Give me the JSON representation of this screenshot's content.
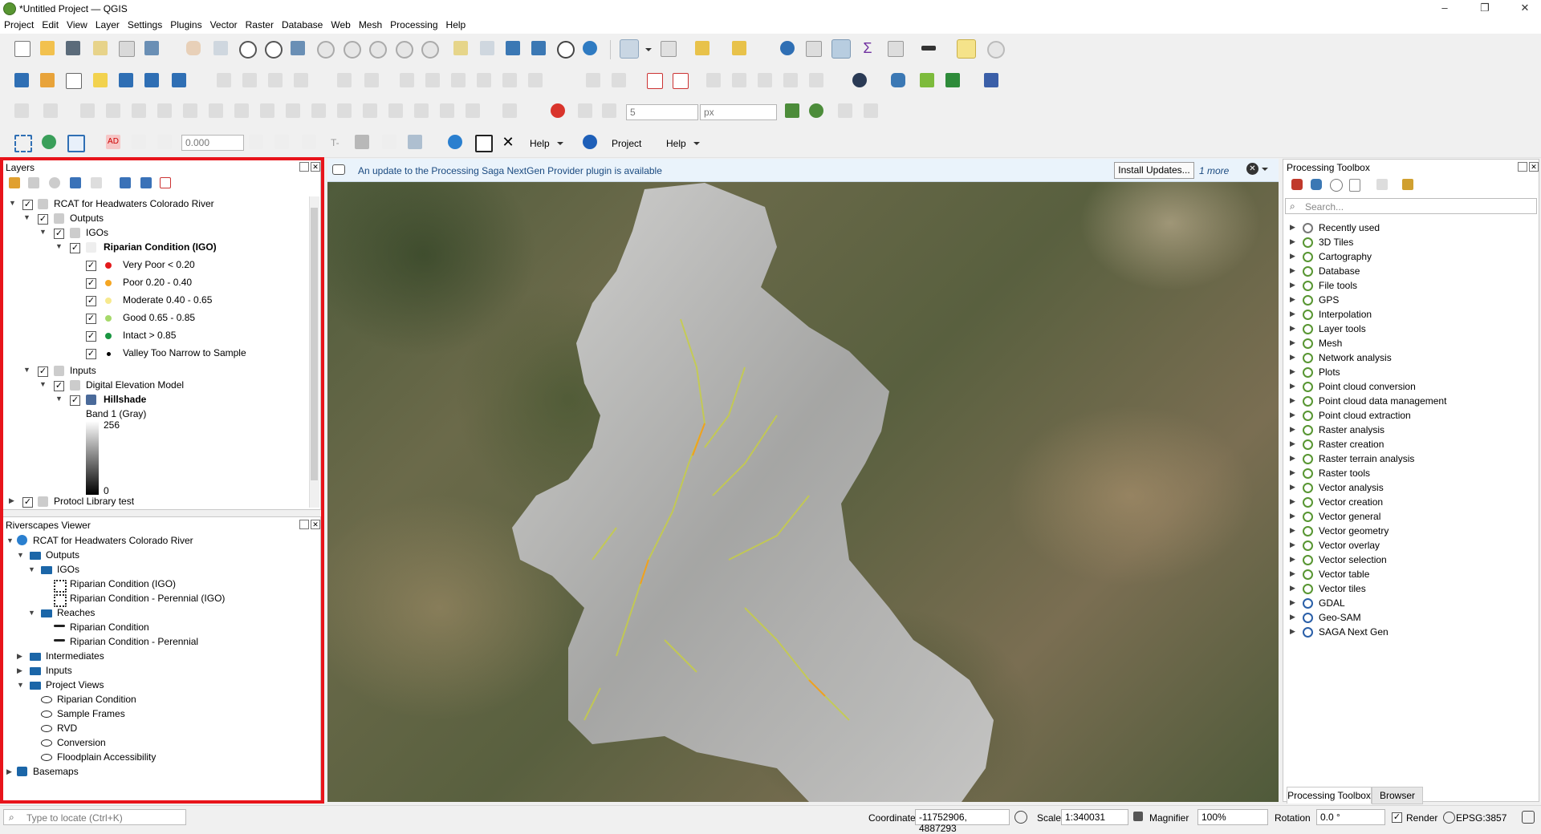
{
  "window": {
    "title": "*Untitled Project — QGIS"
  },
  "menu": [
    "Project",
    "Edit",
    "View",
    "Layer",
    "Settings",
    "Plugins",
    "Vector",
    "Raster",
    "Database",
    "Web",
    "Mesh",
    "Processing",
    "Help"
  ],
  "toolbar": {
    "snap_tolerance": "5",
    "snap_units": "px",
    "offset_value": "0.000",
    "help_label": "Help",
    "project_label": "Project",
    "help2_label": "Help",
    "label_ad": "AD",
    "label_t": "T-"
  },
  "layers_panel": {
    "title": "Layers",
    "items": [
      {
        "label": "RCAT for Headwaters Colorado River"
      },
      {
        "label": "Outputs"
      },
      {
        "label": "IGOs"
      },
      {
        "label": "Riparian Condition (IGO)"
      },
      {
        "label": "Very Poor < 0.20",
        "color": "#e31a1c"
      },
      {
        "label": "Poor 0.20 - 0.40",
        "color": "#f5a623"
      },
      {
        "label": "Moderate 0.40 - 0.65",
        "color": "#f7e98e"
      },
      {
        "label": "Good 0.65 - 0.85",
        "color": "#a6d96a"
      },
      {
        "label": "Intact > 0.85",
        "color": "#1a9641"
      },
      {
        "label": "Valley Too Narrow to Sample",
        "color": "#000000"
      },
      {
        "label": "Inputs"
      },
      {
        "label": "Digital Elevation Model"
      },
      {
        "label": "Hillshade"
      },
      {
        "label": "Band 1 (Gray)"
      },
      {
        "label": "256"
      },
      {
        "label": "0"
      },
      {
        "label": "Protocl Library test"
      }
    ]
  },
  "riverscapes_panel": {
    "title": "Riverscapes Viewer",
    "items": [
      {
        "label": "RCAT for Headwaters Colorado River"
      },
      {
        "label": "Outputs"
      },
      {
        "label": "IGOs"
      },
      {
        "label": "Riparian Condition (IGO)"
      },
      {
        "label": "Riparian Condition - Perennial (IGO)"
      },
      {
        "label": "Reaches"
      },
      {
        "label": "Riparian Condition"
      },
      {
        "label": "Riparian Condition - Perennial"
      },
      {
        "label": "Intermediates"
      },
      {
        "label": "Inputs"
      },
      {
        "label": "Project Views"
      },
      {
        "label": "Riparian Condition"
      },
      {
        "label": "Sample Frames"
      },
      {
        "label": "RVD"
      },
      {
        "label": "Conversion"
      },
      {
        "label": "Floodplain Accessibility"
      },
      {
        "label": "Basemaps"
      }
    ]
  },
  "banner": {
    "message": "An update to the Processing Saga NextGen Provider plugin is available",
    "button": "Install Updates...",
    "more": "1 more"
  },
  "processing_toolbox": {
    "title": "Processing Toolbox",
    "search_placeholder": "Search...",
    "items": [
      "Recently used",
      "3D Tiles",
      "Cartography",
      "Database",
      "File tools",
      "GPS",
      "Interpolation",
      "Layer tools",
      "Mesh",
      "Network analysis",
      "Plots",
      "Point cloud conversion",
      "Point cloud data management",
      "Point cloud extraction",
      "Raster analysis",
      "Raster creation",
      "Raster terrain analysis",
      "Raster tools",
      "Vector analysis",
      "Vector creation",
      "Vector general",
      "Vector geometry",
      "Vector overlay",
      "Vector selection",
      "Vector table",
      "Vector tiles",
      "GDAL",
      "Geo-SAM",
      "SAGA Next Gen"
    ],
    "tabs": [
      "Processing Toolbox",
      "Browser"
    ]
  },
  "statusbar": {
    "locate_placeholder": "Type to locate (Ctrl+K)",
    "coordinate_label": "Coordinate",
    "coordinate_value": "-11752906, 4887293",
    "scale_label": "Scale",
    "scale_value": "1:340031",
    "magnifier_label": "Magnifier",
    "magnifier_value": "100%",
    "rotation_label": "Rotation",
    "rotation_value": "0.0 °",
    "render_label": "Render",
    "crs": "EPSG:3857"
  }
}
